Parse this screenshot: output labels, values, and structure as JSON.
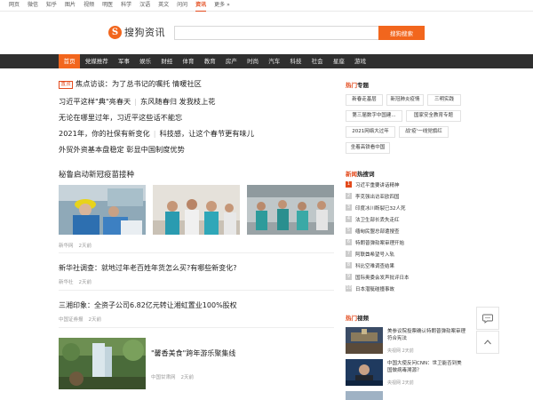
{
  "topnav": [
    "网页",
    "微信",
    "知乎",
    "图片",
    "视频",
    "明医",
    "科学",
    "汉语",
    "英文",
    "问问",
    "资讯",
    "更多 »"
  ],
  "topnav_active_index": 10,
  "logo": {
    "mark": "S",
    "text": "搜狗资讯"
  },
  "search": {
    "value": "",
    "placeholder": "",
    "button": "搜狗搜索"
  },
  "channels": [
    "首页",
    "党媒推荐",
    "军事",
    "娱乐",
    "财经",
    "体育",
    "教育",
    "房产",
    "时尚",
    "汽车",
    "科技",
    "社会",
    "星座",
    "游戏"
  ],
  "channel_active_index": 0,
  "headlines": {
    "h1_tag": "置顶",
    "h1": "焦点访谈：为了总书记的嘱托 情暖社区",
    "h2a": "习近平这样\"典\"亮春天",
    "h2b": "东风随春归 发我枝上花",
    "h3": "无论在哪里过年，习近平这些话不能忘",
    "h4a": "2021年，你的社保有新变化",
    "h4b": "科技感，让这个春节更有味儿",
    "h5": "外贸外资基本盘稳定 彰显中国制度优势"
  },
  "feature": {
    "title": "秘鲁启动新冠疫苗接种",
    "source": "新华网",
    "time": "2天前"
  },
  "news": [
    {
      "title": "新华社调查：就地过年老百姓年货怎么买?有哪些新变化?",
      "source": "新华社",
      "time": "2天前"
    },
    {
      "title": "三湘印象：全资子公司6.82亿元转让湘虹置业100%股权",
      "source": "中国证券报",
      "time": "2天前"
    },
    {
      "title": "\"馨香美食\"跨年游乐聚集线",
      "source": "中国甘肃网",
      "time": "2天前"
    }
  ],
  "side": {
    "topics_title_red": "热门",
    "topics_title": "专题",
    "topics": [
      "新春走基层",
      "新冠肺炎疫情",
      "三明实践",
      "第三届数字中国建...",
      "国家安全教育专题",
      "2021网络大过年",
      "战'疫'一线党旗红",
      "坐着高铁看中国"
    ],
    "hot_title_red": "新闻",
    "hot_title": "热搜词",
    "hot": [
      "习近平重要讲话精神",
      "李克强出访亚欧四国",
      "印度冰川断裂已32人死",
      "法卫生部长丢失走红",
      "缅甸民盟总部遭搜查",
      "特朗普弹劾案审理开始",
      "阿联酋希望号入轨",
      "科比空难调查结果",
      "国际奥委会发声批评日本",
      "日本潜艇碰撞事故"
    ],
    "video_title_red": "热门",
    "video_title": "视频",
    "videos": [
      {
        "title": "美参议院投票确认特朗普弹劾案审理符合宪法",
        "source": "央视网",
        "time": "2天前"
      },
      {
        "title": "中国大使反问CNN：世卫能否到美国做病毒溯源？",
        "source": "央视网",
        "time": "2天前"
      },
      {
        "title": "",
        "source": "",
        "time": ""
      }
    ]
  },
  "colors": {
    "accent": "#f2661d",
    "channel_bg": "#2f2f2f",
    "tag": "#e34a1c"
  },
  "icons": {
    "feedback": "chat-bubble-icon",
    "back_to_top": "chevron-up-icon"
  }
}
